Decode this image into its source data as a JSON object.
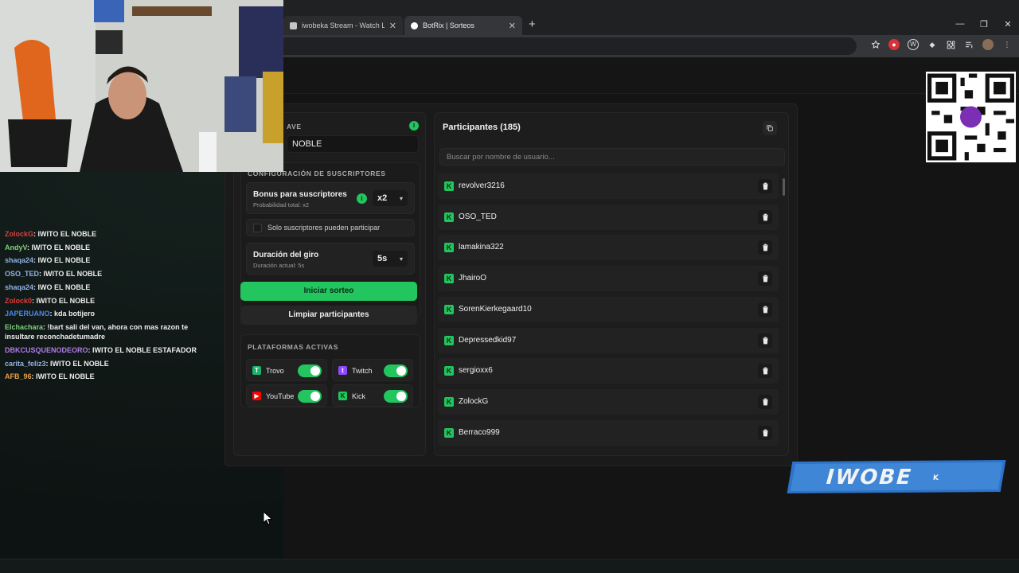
{
  "browser": {
    "tabs": [
      {
        "title": "iwobeka Stream - Watch Live o",
        "active": false
      },
      {
        "title": "BotRix | Sorteos",
        "active": true
      }
    ],
    "new_tab": "+",
    "window": {
      "minimize": "—",
      "restore": "❐",
      "close": "✕"
    }
  },
  "raffle": {
    "keyword_label": "AVE",
    "keyword_value": "NOBLE",
    "subs_section_label": "CONFIGURACIÓN DE SUSCRIPTORES",
    "bonus": {
      "title": "Bonus para suscriptores",
      "subtitle": "Probabilidad total: x2",
      "value": "x2"
    },
    "subs_only_label": "Solo suscriptores pueden participar",
    "duration": {
      "title": "Duración del giro",
      "subtitle": "Duración actual: 5s",
      "value": "5s"
    },
    "start_label": "Iniciar sorteo",
    "clear_label": "Limpiar participantes",
    "platforms_label": "PLATAFORMAS ACTIVAS",
    "platforms": [
      {
        "name": "Trovo",
        "enabled": true,
        "color": "#19b46a"
      },
      {
        "name": "Twitch",
        "enabled": true,
        "color": "#9146ff"
      },
      {
        "name": "YouTube",
        "enabled": true,
        "color": "#ff0000"
      },
      {
        "name": "Kick",
        "enabled": true,
        "color": "#22c55e"
      }
    ]
  },
  "participants": {
    "title": "Participantes (185)",
    "search_placeholder": "Buscar por nombre de usuario...",
    "items": [
      "revolver3216",
      "OSO_TED",
      "lamakina322",
      "JhairoO",
      "SorenKierkegaard10",
      "Depressedkid97",
      "sergioxx6",
      "ZolockG",
      "Berraco999"
    ]
  },
  "chat": [
    {
      "user": "ZolockG",
      "color": "#e03c3c",
      "msg": ": IWITO EL NOBLE"
    },
    {
      "user": "AndyV",
      "color": "#7ecf7e",
      "msg": ": IWITO EL NOBLE"
    },
    {
      "user": "shaqa24",
      "color": "#8fb2e8",
      "msg": ": IWO EL NOBLE"
    },
    {
      "user": "OSO_TED",
      "color": "#8fb2e8",
      "msg": ": IWITO EL NOBLE"
    },
    {
      "user": "shaqa24",
      "color": "#8fb2e8",
      "msg": ": IWO EL NOBLE"
    },
    {
      "user": "Zolock0",
      "color": "#e03c3c",
      "msg": ": IWITO EL NOBLE"
    },
    {
      "user": "JAPERUANO",
      "color": "#4a86e8",
      "msg": ": kda botijero"
    },
    {
      "user": "Elchachara",
      "color": "#7ecf7e",
      "msg": ": !bart sali del van, ahora con mas razon te insultare reconchadetumadre",
      "wrap": true
    },
    {
      "user": "DBKCUSQUENODEORO",
      "color": "#b07ce8",
      "msg": ": IWITO EL NOBLE ESTAFADOR"
    },
    {
      "user": "carita_feliz3",
      "color": "#8fb2e8",
      "msg": ": IWITO EL NOBLE"
    },
    {
      "user": "AFB_96",
      "color": "#e8a04a",
      "msg": ": IWITO EL NOBLE"
    }
  ],
  "overlay": {
    "brand_text": "IWOBE",
    "brand_suffix": "K"
  },
  "colors": {
    "accent": "#22c55e",
    "panel": "#1d1d1d",
    "row": "#222222"
  }
}
